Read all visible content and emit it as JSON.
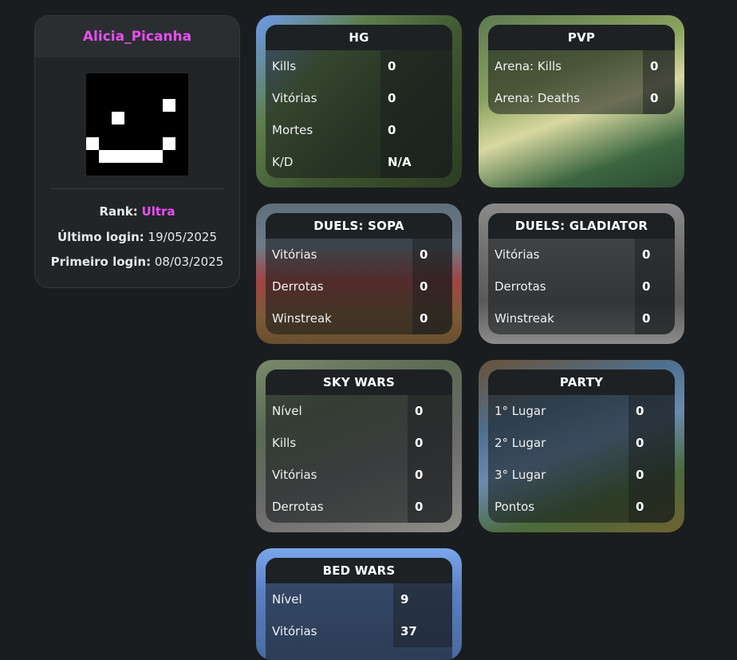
{
  "profile": {
    "username": "Alicia_Picanha",
    "rank_label": "Rank:",
    "rank_value": "Ultra",
    "last_login_label": "Último login:",
    "last_login_value": "19/05/2025",
    "first_login_label": "Primeiro login:",
    "first_login_value": "08/03/2025",
    "avatar_icon": "pixel-smiley-skin-icon"
  },
  "colors": {
    "background": "#1a1d1f",
    "accent": "#e84ef0",
    "card_title": "#1d2124"
  },
  "cards": {
    "hg": {
      "title": "HG",
      "rows": [
        {
          "label": "Kills",
          "value": "0"
        },
        {
          "label": "Vitórias",
          "value": "0"
        },
        {
          "label": "Mortes",
          "value": "0"
        },
        {
          "label": "K/D",
          "value": "N/A"
        }
      ]
    },
    "pvp": {
      "title": "PVP",
      "rows": [
        {
          "label": "Arena: Kills",
          "value": "0"
        },
        {
          "label": "Arena: Deaths",
          "value": "0"
        }
      ]
    },
    "sopa": {
      "title": "DUELS: SOPA",
      "rows": [
        {
          "label": "Vitórias",
          "value": "0"
        },
        {
          "label": "Derrotas",
          "value": "0"
        },
        {
          "label": "Winstreak",
          "value": "0"
        }
      ]
    },
    "gladiator": {
      "title": "DUELS: GLADIATOR",
      "rows": [
        {
          "label": "Vitórias",
          "value": "0"
        },
        {
          "label": "Derrotas",
          "value": "0"
        },
        {
          "label": "Winstreak",
          "value": "0"
        }
      ]
    },
    "skywars": {
      "title": "SKY WARS",
      "rows": [
        {
          "label": "Nível",
          "value": "0"
        },
        {
          "label": "Kills",
          "value": "0"
        },
        {
          "label": "Vitórias",
          "value": "0"
        },
        {
          "label": "Derrotas",
          "value": "0"
        }
      ]
    },
    "party": {
      "title": "PARTY",
      "rows": [
        {
          "label": "1° Lugar",
          "value": "0"
        },
        {
          "label": "2° Lugar",
          "value": "0"
        },
        {
          "label": "3° Lugar",
          "value": "0"
        },
        {
          "label": "Pontos",
          "value": "0"
        }
      ]
    },
    "bedwars": {
      "title": "BED WARS",
      "rows": [
        {
          "label": "Nível",
          "value": "9"
        },
        {
          "label": "Vitórias",
          "value": "37"
        }
      ]
    }
  }
}
